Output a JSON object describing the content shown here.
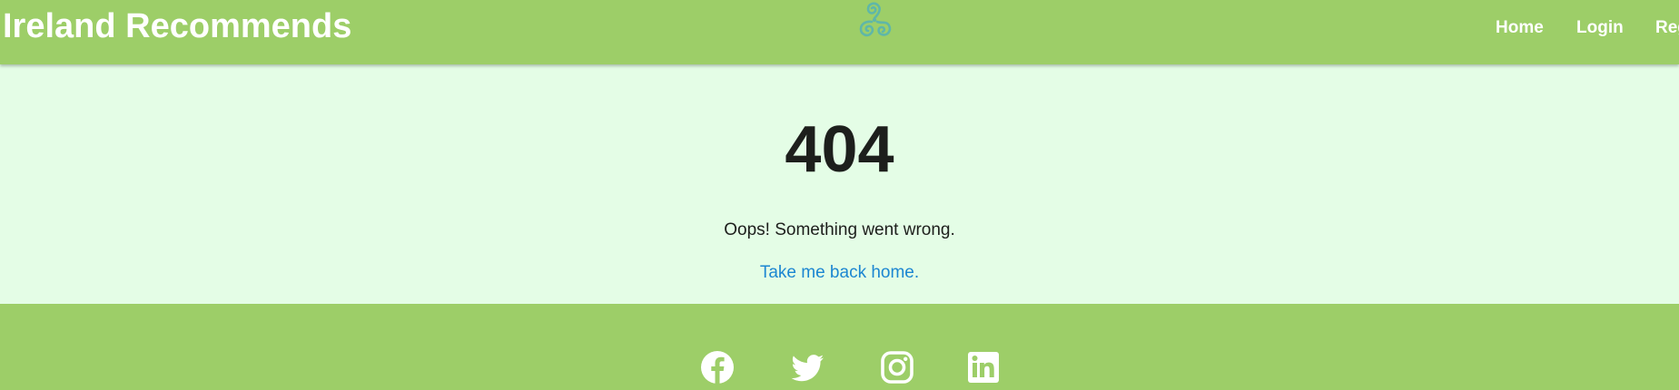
{
  "header": {
    "brand": "Ireland Recommends",
    "logo_icon": "triskele-icon",
    "nav": {
      "home": "Home",
      "login": "Login",
      "register": "Reg"
    }
  },
  "main": {
    "error_code": "404",
    "message": "Oops! Something went wrong.",
    "home_link": "Take me back home."
  },
  "footer": {
    "social_icons": [
      "facebook-icon",
      "twitter-icon",
      "instagram-icon",
      "linkedin-icon"
    ]
  },
  "colors": {
    "header_bg": "#9dce68",
    "page_bg": "#e4fde6",
    "text": "#1d1f1c",
    "link": "#1c86d1",
    "logo": "#5fb7a8"
  }
}
